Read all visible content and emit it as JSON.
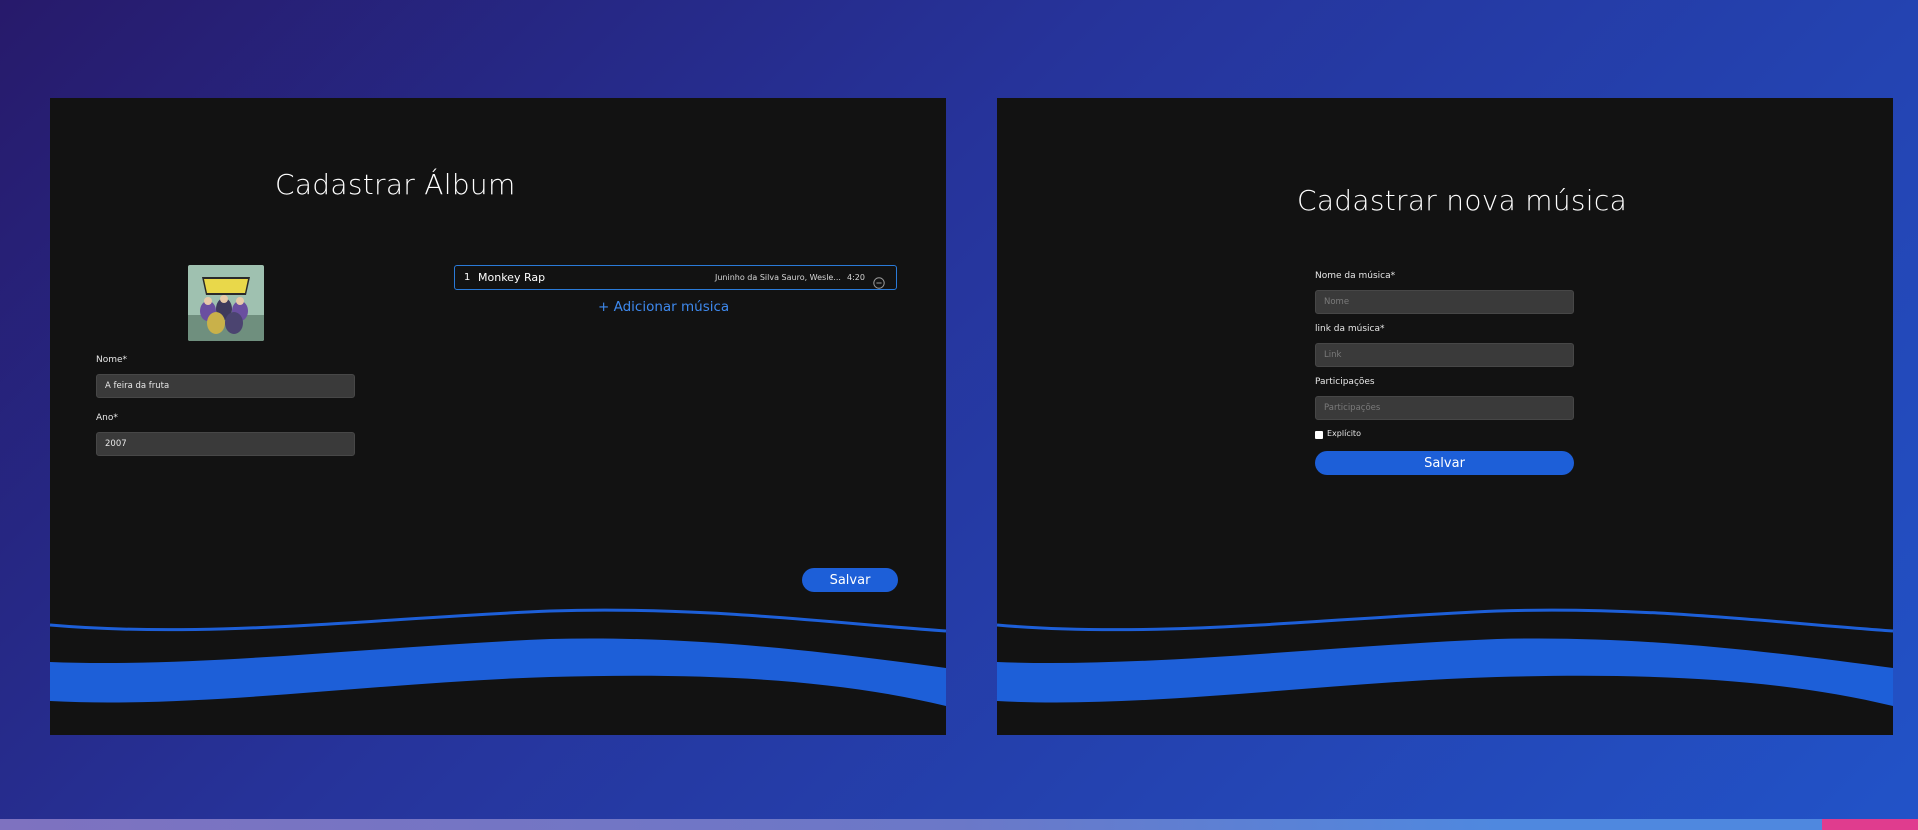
{
  "album_form": {
    "title": "Cadastrar  Álbum",
    "name_label": "Nome*",
    "name_value": "A feira da fruta",
    "year_label": "Ano*",
    "year_value": "2007",
    "tracks": [
      {
        "number": "1",
        "title": "Monkey Rap",
        "artists": "Juninho da Silva Sauro, Wesle...",
        "duration": "4:20"
      }
    ],
    "add_track_label": "+ Adicionar música",
    "save_label": "Salvar",
    "cover_icon": "album-cover-image",
    "remove_icon": "minus-circle-icon"
  },
  "song_form": {
    "title": "Cadastrar nova música",
    "name_label": "Nome da música*",
    "name_placeholder": "Nome",
    "link_label": "link da música*",
    "link_placeholder": "Link",
    "participants_label": "Participações",
    "participants_placeholder": "Participações",
    "explicit_label": "Explícito",
    "explicit_checked": false,
    "save_label": "Salvar"
  },
  "colors": {
    "panel_bg": "#121212",
    "accent": "#1d5fd8",
    "link": "#3e89ee",
    "bottom_accent": "#e03c8e"
  }
}
